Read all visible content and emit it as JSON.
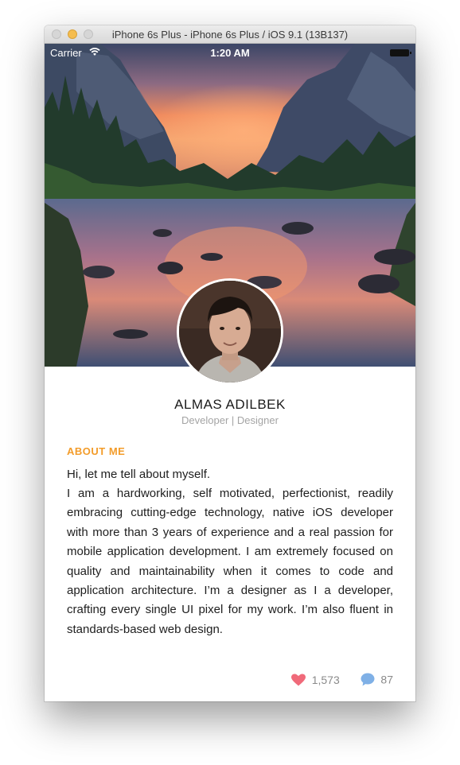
{
  "window": {
    "title": "iPhone 6s Plus - iPhone 6s Plus / iOS 9.1 (13B137)"
  },
  "statusbar": {
    "carrier": "Carrier",
    "time": "1:20 AM"
  },
  "profile": {
    "name": "ALMAS ADILBEK",
    "subtitle": "Developer | Designer"
  },
  "about": {
    "heading": "ABOUT ME",
    "intro": "Hi, let me tell about myself.",
    "body": "I am a hardworking, self motivated, perfectionist, readily embracing cutting-edge technology, native iOS developer with more than 3 years of experience and a real passion for mobile application development. I am extremely focused on quality and maintainability when it comes to code and application architecture. I’m a designer as I a developer, crafting every single UI pixel for my work. I’m also fluent in standards-based web design."
  },
  "stats": {
    "likes": "1,573",
    "comments": "87"
  },
  "colors": {
    "accent": "#f39c2a",
    "like": "#f06a7a",
    "comment": "#7fb0e6"
  },
  "icons": {
    "wifi": "wifi-icon",
    "battery": "battery-icon",
    "like": "heart-icon",
    "comment": "speech-bubble-icon"
  }
}
